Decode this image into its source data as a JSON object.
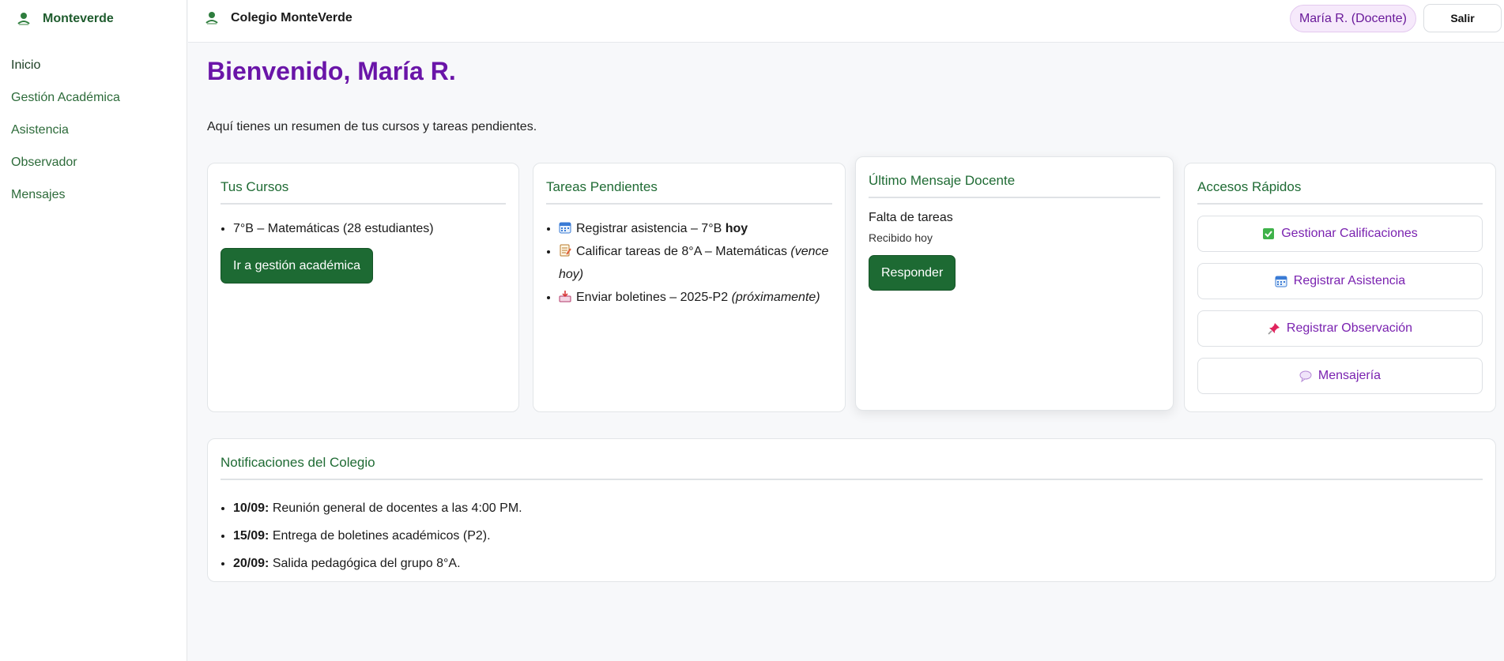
{
  "sidebar": {
    "brand": "Monteverde",
    "items": [
      {
        "label": "Inicio"
      },
      {
        "label": "Gestión Académica"
      },
      {
        "label": "Asistencia"
      },
      {
        "label": "Observador"
      },
      {
        "label": "Mensajes"
      }
    ]
  },
  "topbar": {
    "title": "Colegio MonteVerde",
    "user": "María R. (Docente)",
    "logout": "Salir"
  },
  "main": {
    "welcome": "Bienvenido, María R.",
    "summary": "Aquí tienes un resumen de tus cursos y tareas pendientes."
  },
  "cursos": {
    "title": "Tus Cursos",
    "items": [
      "7°B – Matemáticas (28 estudiantes)"
    ],
    "button": "Ir a gestión académica"
  },
  "tareas": {
    "title": "Tareas Pendientes",
    "items": [
      {
        "icon": "calendar-icon",
        "text": "Registrar asistencia – 7°B ",
        "strong": "hoy",
        "em": ""
      },
      {
        "icon": "memo-icon",
        "text": "Calificar tareas de 8°A – Matemáticas ",
        "strong": "",
        "em": "(vence hoy)"
      },
      {
        "icon": "inbox-tray-icon",
        "text": "Enviar boletines – 2025-P2 ",
        "strong": "",
        "em": "(próximamente)"
      }
    ]
  },
  "mensaje": {
    "title": "Último Mensaje Docente",
    "subject": "Falta de tareas",
    "received": "Recibido hoy",
    "button": "Responder"
  },
  "accesos": {
    "title": "Accesos Rápidos",
    "items": [
      {
        "icon": "check-box-icon",
        "label": "Gestionar Calificaciones"
      },
      {
        "icon": "calendar-icon",
        "label": "Registrar Asistencia"
      },
      {
        "icon": "pushpin-icon",
        "label": "Registrar Observación"
      },
      {
        "icon": "speech-balloon-icon",
        "label": "Mensajería"
      }
    ]
  },
  "notificaciones": {
    "title": "Notificaciones del Colegio",
    "items": [
      {
        "date": "10/09:",
        "text": " Reunión general de docentes a las 4:00 PM."
      },
      {
        "date": "15/09:",
        "text": " Entrega de boletines académicos (P2)."
      },
      {
        "date": "20/09:",
        "text": " Salida pedagógica del grupo 8°A."
      }
    ]
  },
  "colors": {
    "brand_green": "#1f6b34",
    "accent_purple": "#6a15a8",
    "button_green": "#1d6a33"
  }
}
